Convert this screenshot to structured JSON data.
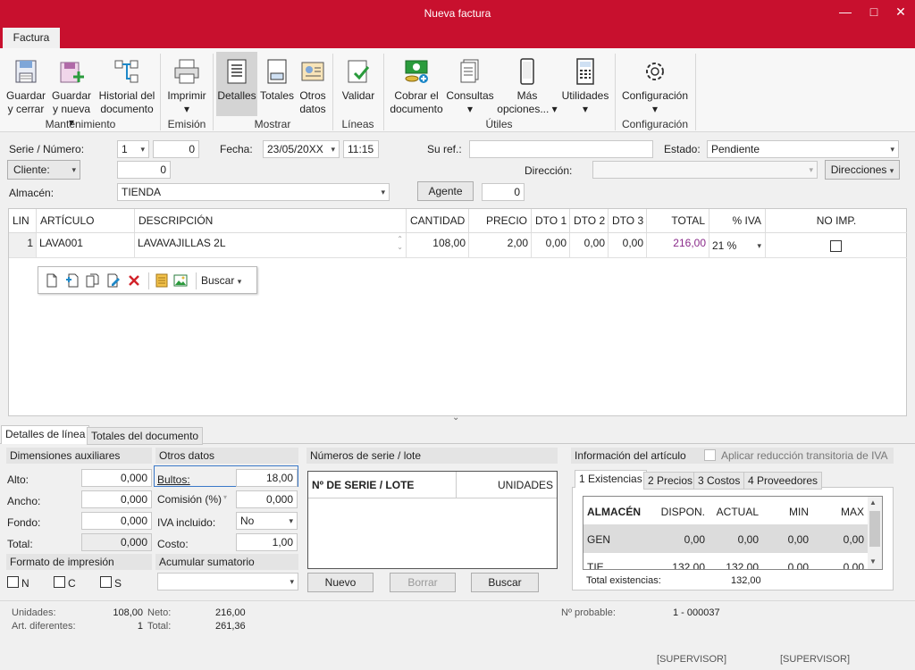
{
  "window": {
    "title": "Nueva factura",
    "min": "—",
    "max": "□",
    "close": "✕"
  },
  "tab": "Factura",
  "ribbon": {
    "buttons": [
      {
        "id": "guardar-cerrar",
        "l1": "Guardar",
        "l2": "y cerrar"
      },
      {
        "id": "guardar-nueva",
        "l1": "Guardar",
        "l2": "y nueva ▾"
      },
      {
        "id": "historial",
        "l1": "Historial del",
        "l2": "documento"
      },
      {
        "id": "imprimir",
        "l1": "Imprimir",
        "l2": "▾"
      },
      {
        "id": "detalles",
        "l1": "Detalles",
        "l2": ""
      },
      {
        "id": "totales",
        "l1": "Totales",
        "l2": ""
      },
      {
        "id": "otros-datos",
        "l1": "Otros",
        "l2": "datos"
      },
      {
        "id": "validar",
        "l1": "Validar",
        "l2": ""
      },
      {
        "id": "cobrar",
        "l1": "Cobrar el",
        "l2": "documento"
      },
      {
        "id": "consultas",
        "l1": "Consultas",
        "l2": "▾"
      },
      {
        "id": "mas-opciones",
        "l1": "Más",
        "l2": "opciones... ▾"
      },
      {
        "id": "utilidades",
        "l1": "Utilidades",
        "l2": "▾"
      },
      {
        "id": "configuracion",
        "l1": "Configuración",
        "l2": "▾"
      }
    ],
    "groups": [
      "Mantenimiento",
      "Emisión",
      "Mostrar",
      "Líneas",
      "Útiles",
      "Configuración"
    ]
  },
  "header": {
    "serie_label": "Serie / Número:",
    "serie": "1",
    "numero": "0",
    "fecha_label": "Fecha:",
    "fecha": "23/05/20XX",
    "hora": "11:15",
    "suref_label": "Su ref.:",
    "suref": "",
    "estado_label": "Estado:",
    "estado": "Pendiente",
    "cliente_label": "Cliente:",
    "cliente": "0",
    "direccion_label": "Dirección:",
    "direccion": "",
    "direcciones_btn": "Direcciones",
    "almacen_label": "Almacén:",
    "almacen": "TIENDA",
    "agente_btn": "Agente",
    "agente": "0"
  },
  "grid": {
    "columns": [
      "LIN",
      "ARTÍCULO",
      "DESCRIPCIÓN",
      "CANTIDAD",
      "PRECIO",
      "DTO 1",
      "DTO 2",
      "DTO 3",
      "TOTAL",
      "% IVA",
      "NO IMP."
    ],
    "rows": [
      {
        "lin": "1",
        "articulo": "LAVA001",
        "descripcion": "LAVAVAJILLAS 2L",
        "cantidad": "108,00",
        "precio": "2,00",
        "dto1": "0,00",
        "dto2": "0,00",
        "dto3": "0,00",
        "total": "216,00",
        "iva": "21 %",
        "noimp": false
      }
    ],
    "buscar": "Buscar"
  },
  "bottom_tabs": [
    "Detalles de línea",
    "Totales del documento"
  ],
  "dimensiones": {
    "title": "Dimensiones auxiliares",
    "alto_label": "Alto:",
    "alto": "0,000",
    "ancho_label": "Ancho:",
    "ancho": "0,000",
    "fondo_label": "Fondo:",
    "fondo": "0,000",
    "total_label": "Total:",
    "total": "0,000"
  },
  "formato": {
    "title": "Formato de impresión",
    "n": "N",
    "c": "C",
    "s": "S"
  },
  "otros": {
    "title": "Otros datos",
    "bultos_label": "Bultos:",
    "bultos": "18,00",
    "comision_label": "Comisión (%)",
    "comision": "0,000",
    "iva_label": "IVA incluido:",
    "iva": "No",
    "costo_label": "Costo:",
    "costo": "1,00"
  },
  "acumular": {
    "title": "Acumular sumatorio",
    "value": ""
  },
  "series": {
    "title": "Números de serie / lote",
    "col1": "Nº DE SERIE / LOTE",
    "col2": "UNIDADES",
    "nuevo": "Nuevo",
    "borrar": "Borrar",
    "buscar": "Buscar"
  },
  "info": {
    "title": "Información del artículo",
    "reduccion": "Aplicar reducción transitoria de IVA",
    "tabs": [
      "1 Existencias",
      "2 Precios",
      "3 Costos",
      "4 Proveedores"
    ],
    "columns": [
      "ALMACÉN",
      "DISPON.",
      "ACTUAL",
      "MIN",
      "MAX"
    ],
    "rows": [
      [
        "GEN",
        "0,00",
        "0,00",
        "0,00",
        "0,00"
      ],
      [
        "TIE",
        "132,00",
        "132,00",
        "0,00",
        "0,00"
      ]
    ],
    "total_label": "Total existencias:",
    "total": "132,00"
  },
  "status": {
    "unidades_label": "Unidades:",
    "unidades": "108,00",
    "artdif_label": "Art. diferentes:",
    "artdif": "1",
    "neto_label": "Neto:",
    "neto": "216,00",
    "total_label": "Total:",
    "total": "261,36",
    "nprob_label": "Nº probable:",
    "nprob": "1 - 000037",
    "user1": "[SUPERVISOR]",
    "user2": "[SUPERVISOR]"
  }
}
